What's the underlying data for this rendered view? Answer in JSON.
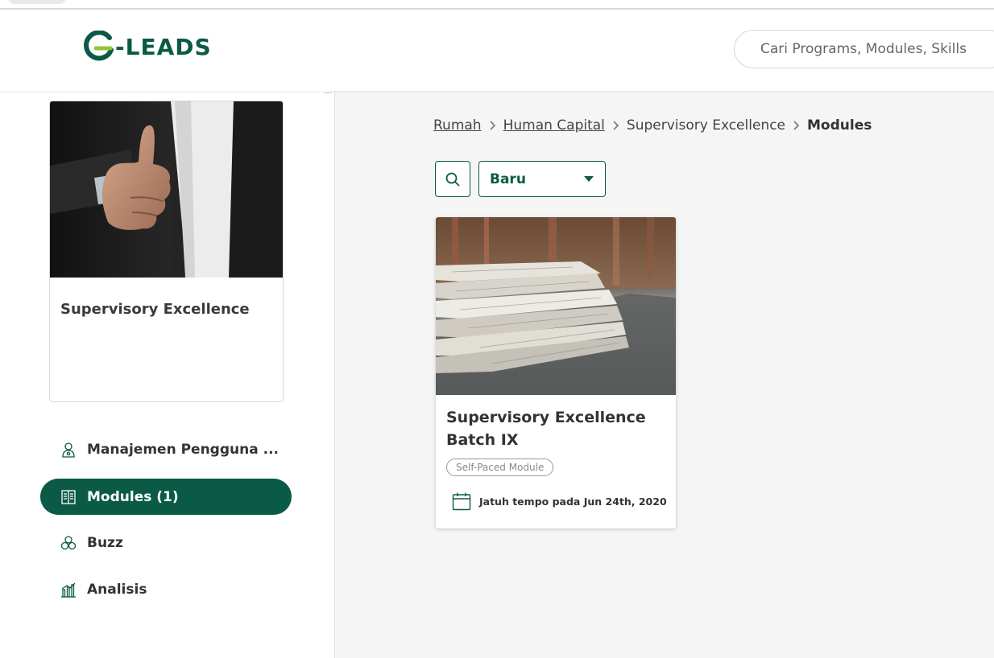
{
  "header": {
    "logo_text": "-LEADS",
    "logo_letter": "G",
    "search_placeholder": "Cari Programs, Modules, Skills"
  },
  "sidebar": {
    "program_title": "Supervisory Excellence",
    "items": [
      {
        "label": "Manajemen Pengguna ...",
        "icon": "user-management-icon",
        "active": false
      },
      {
        "label": "Modules (1)",
        "icon": "modules-icon",
        "active": true
      },
      {
        "label": "Buzz",
        "icon": "buzz-icon",
        "active": false
      },
      {
        "label": "Analisis",
        "icon": "analytics-icon",
        "active": false
      }
    ]
  },
  "breadcrumb": {
    "items": [
      "Rumah",
      "Human Capital",
      "Supervisory Excellence"
    ],
    "current": "Modules"
  },
  "filters": {
    "search_icon": "search-icon",
    "sort_value": "Baru"
  },
  "modules": [
    {
      "title": "Supervisory Excellence Batch IX",
      "tag": "Self-Paced Module",
      "due_text": "Jatuh tempo pada Jun 24th, 2020"
    }
  ],
  "colors": {
    "primary": "#0a5a46",
    "accent": "#8dc63f",
    "background": "#f5f5f5"
  }
}
